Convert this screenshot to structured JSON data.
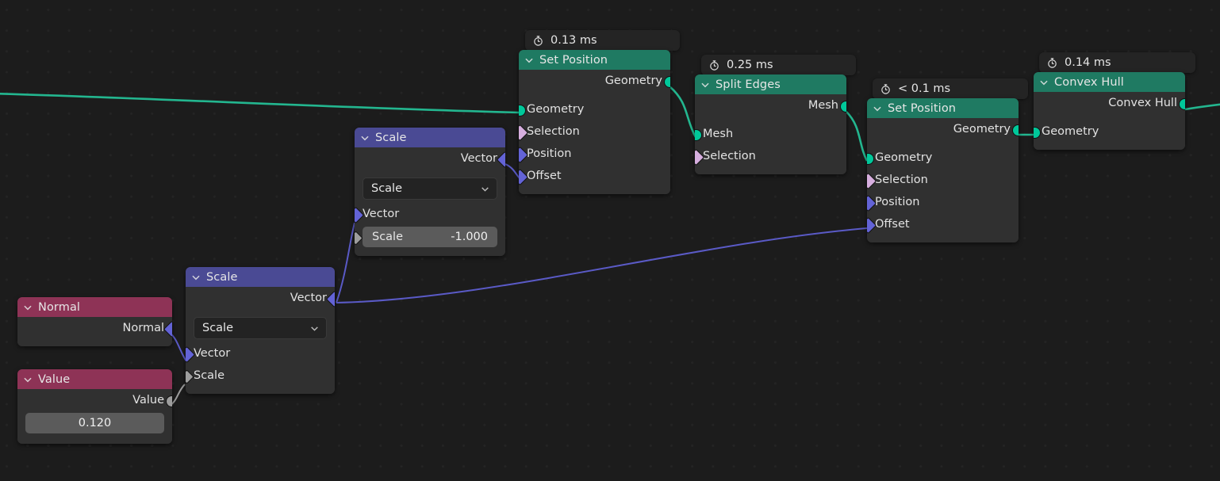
{
  "editor": {
    "name": "geometry-node-editor",
    "background": "#1c1c1c"
  },
  "colors": {
    "header_green": "#1f7a62",
    "header_indigo": "#4a4a94",
    "header_magenta": "#8e3356",
    "node_body": "#303030",
    "link_green": "#23b68f",
    "link_purple": "#5a5ac6",
    "link_grey": "#9d9d9d",
    "socket_geometry": "#00c89a",
    "socket_vector": "#6363d6",
    "socket_boolean": "#d6aede",
    "socket_value": "#9d9d9d"
  },
  "nodes": [
    {
      "id": "normal",
      "title": "Normal",
      "timer": null,
      "outputs": [
        {
          "label": "Normal",
          "type": "vector"
        }
      ],
      "inputs": [],
      "widgets": []
    },
    {
      "id": "value",
      "title": "Value",
      "timer": null,
      "outputs": [
        {
          "label": "Value",
          "type": "value"
        }
      ],
      "inputs": [],
      "widgets": [
        {
          "kind": "field",
          "label": "",
          "value": "0.120"
        }
      ]
    },
    {
      "id": "scale-left",
      "title": "Scale",
      "timer": null,
      "outputs": [
        {
          "label": "Vector",
          "type": "vector"
        }
      ],
      "inputs": [
        {
          "label": "Vector",
          "type": "vector"
        },
        {
          "label": "Scale",
          "type": "value"
        }
      ],
      "widgets": [
        {
          "kind": "dropdown",
          "value": "Scale"
        }
      ]
    },
    {
      "id": "scale-right",
      "title": "Scale",
      "timer": null,
      "outputs": [
        {
          "label": "Vector",
          "type": "vector"
        }
      ],
      "inputs": [
        {
          "label": "Vector",
          "type": "vector"
        },
        {
          "label": "Scale",
          "type": "value",
          "value": "-1.000"
        }
      ],
      "widgets": [
        {
          "kind": "dropdown",
          "value": "Scale"
        },
        {
          "kind": "field",
          "label": "Scale",
          "value": "-1.000"
        }
      ]
    },
    {
      "id": "set-position-1",
      "title": "Set Position",
      "timer": "0.13 ms",
      "outputs": [
        {
          "label": "Geometry",
          "type": "geometry"
        }
      ],
      "inputs": [
        {
          "label": "Geometry",
          "type": "geometry"
        },
        {
          "label": "Selection",
          "type": "boolean"
        },
        {
          "label": "Position",
          "type": "vector"
        },
        {
          "label": "Offset",
          "type": "vector"
        }
      ],
      "widgets": []
    },
    {
      "id": "split-edges",
      "title": "Split Edges",
      "timer": "0.25 ms",
      "outputs": [
        {
          "label": "Mesh",
          "type": "geometry"
        }
      ],
      "inputs": [
        {
          "label": "Mesh",
          "type": "geometry"
        },
        {
          "label": "Selection",
          "type": "boolean"
        }
      ],
      "widgets": []
    },
    {
      "id": "set-position-2",
      "title": "Set Position",
      "timer": "< 0.1 ms",
      "outputs": [
        {
          "label": "Geometry",
          "type": "geometry"
        }
      ],
      "inputs": [
        {
          "label": "Geometry",
          "type": "geometry"
        },
        {
          "label": "Selection",
          "type": "boolean"
        },
        {
          "label": "Position",
          "type": "vector"
        },
        {
          "label": "Offset",
          "type": "vector"
        }
      ],
      "widgets": []
    },
    {
      "id": "convex-hull",
      "title": "Convex Hull",
      "timer": "0.14 ms",
      "outputs": [
        {
          "label": "Convex Hull",
          "type": "geometry"
        }
      ],
      "inputs": [
        {
          "label": "Geometry",
          "type": "geometry"
        }
      ],
      "widgets": []
    }
  ],
  "icons": {
    "timer": "stopwatch-icon",
    "collapse": "chevron-down-icon",
    "dropdown": "chevron-down-icon"
  }
}
